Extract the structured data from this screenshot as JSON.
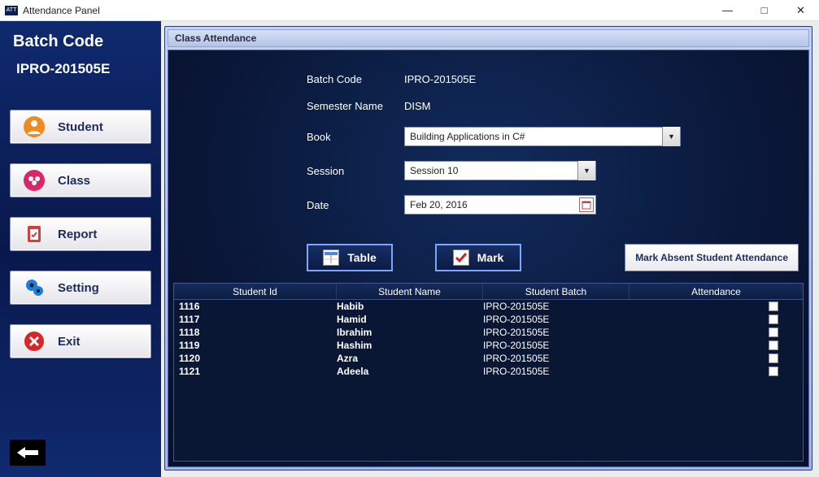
{
  "window": {
    "title": "Attendance Panel",
    "icon_label": "ATT"
  },
  "sidebar": {
    "heading": "Batch Code",
    "batch_value": "IPRO-201505E",
    "items": [
      {
        "label": "Student",
        "icon": "student-icon"
      },
      {
        "label": "Class",
        "icon": "class-icon"
      },
      {
        "label": "Report",
        "icon": "report-icon"
      },
      {
        "label": "Setting",
        "icon": "setting-icon"
      },
      {
        "label": "Exit",
        "icon": "exit-icon"
      }
    ]
  },
  "panel": {
    "title": "Class Attendance",
    "fields": {
      "batch_code_label": "Batch Code",
      "batch_code_value": "IPRO-201505E",
      "semester_label": "Semester Name",
      "semester_value": "DISM",
      "book_label": "Book",
      "book_value": "Building Applications in C#",
      "session_label": "Session",
      "session_value": "Session 10",
      "date_label": "Date",
      "date_value": "Feb 20, 2016"
    },
    "actions": {
      "table_btn": "Table",
      "mark_btn": "Mark",
      "mark_absent_btn": "Mark Absent Student Attendance"
    },
    "table": {
      "columns": [
        "Student Id",
        "Student Name",
        "Student Batch",
        "Attendance"
      ],
      "rows": [
        {
          "id": "1116",
          "name": "Habib",
          "batch": "IPRO-201505E",
          "att": false
        },
        {
          "id": "1117",
          "name": "Hamid",
          "batch": "IPRO-201505E",
          "att": false
        },
        {
          "id": "1118",
          "name": "Ibrahim",
          "batch": "IPRO-201505E",
          "att": false
        },
        {
          "id": "1119",
          "name": "Hashim",
          "batch": "IPRO-201505E",
          "att": false
        },
        {
          "id": "1120",
          "name": "Azra",
          "batch": "IPRO-201505E",
          "att": false
        },
        {
          "id": "1121",
          "name": "Adeela",
          "batch": "IPRO-201505E",
          "att": false
        }
      ]
    }
  }
}
